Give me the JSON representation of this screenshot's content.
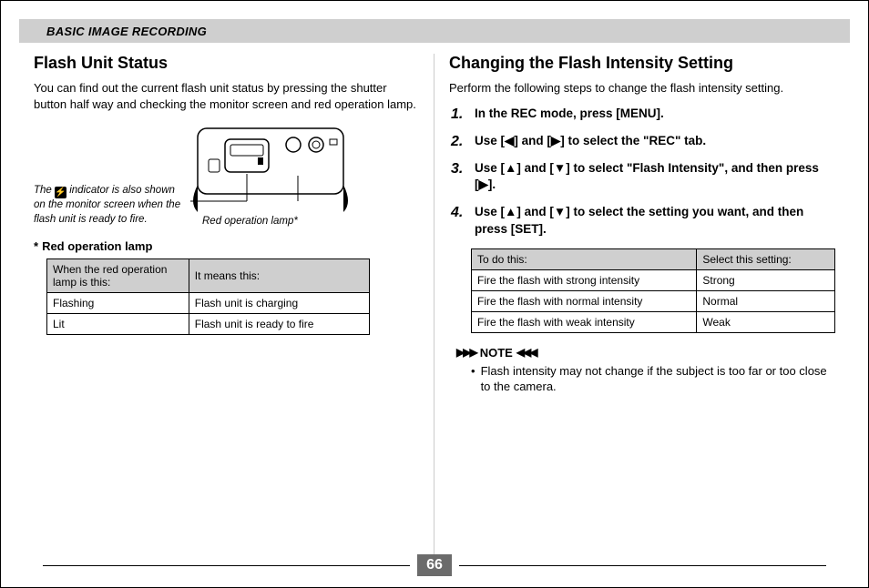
{
  "banner": "BASIC IMAGE RECORDING",
  "left": {
    "heading": "Flash Unit Status",
    "para": "You can find out the current flash unit status by pressing the shutter button half way and checking the monitor screen and red operation lamp.",
    "indicator_pre": "The ",
    "indicator_post": " indicator is also shown on the monitor screen when the flash unit is ready to fire.",
    "red_lamp_caption": "Red operation lamp*",
    "red_lamp_subhead": "Red operation lamp",
    "table": {
      "c1h": "When the red operation lamp is this:",
      "c2h": "It means this:",
      "rows": [
        {
          "c1": "Flashing",
          "c2": "Flash unit is charging"
        },
        {
          "c1": "Lit",
          "c2": "Flash unit is ready to fire"
        }
      ]
    }
  },
  "right": {
    "heading": "Changing the Flash Intensity Setting",
    "para": "Perform the following steps to change the flash intensity setting.",
    "steps": [
      "In the REC mode, press [MENU].",
      "Use [◀] and [▶] to select the \"REC\" tab.",
      "Use [▲] and [▼] to select \"Flash Intensity\", and then press [▶].",
      "Use [▲] and [▼] to select the setting you want, and then press [SET]."
    ],
    "table": {
      "c1h": "To do this:",
      "c2h": "Select this setting:",
      "rows": [
        {
          "c1": "Fire the flash with strong intensity",
          "c2": "Strong"
        },
        {
          "c1": "Fire the flash with normal intensity",
          "c2": "Normal"
        },
        {
          "c1": "Fire the flash with weak intensity",
          "c2": "Weak"
        }
      ]
    },
    "note_label": "NOTE",
    "note_body": "Flash intensity may not change if the subject is too far or too close to the camera."
  },
  "page_number": "66"
}
